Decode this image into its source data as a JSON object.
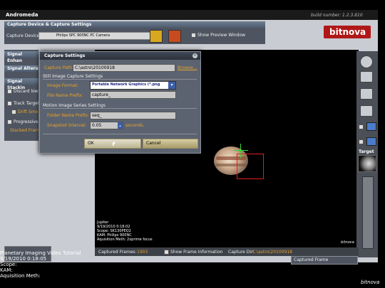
{
  "window": {
    "title": "Andromeda",
    "build": "build number: 1.2.3.810"
  },
  "brand": "bitnova",
  "capture_device": {
    "section": "Capture Device & Capture Settings",
    "label": "Capture Device:",
    "value": "Philips SPC 900NC PC Camera",
    "show_preview": "Show Preview Window"
  },
  "left_panel": {
    "signal_enhance": "Signal Enhan",
    "signal_alter": "Signal Altera",
    "signal_stack": "Signal Stackin",
    "discard": "Discard low",
    "track": "Track Target",
    "drift": "Drift Smoot",
    "progressive": "Progressive",
    "stacked": "Stacked Frame"
  },
  "dialog": {
    "title": "Capture Settings",
    "capture_path_label": "Capture Path:",
    "capture_path": "C:\\astro\\20100918",
    "browse": "Browse...",
    "still_section": "Still Image Capture Settings",
    "image_format_label": "Image Format:",
    "image_format": "Portable Network Graphics (*.png",
    "file_prefix_label": "File Name Prefix:",
    "file_prefix": "capture_",
    "motion_section": "Motion Image Series Settings",
    "folder_prefix_label": "Folder Name Prefix:",
    "folder_prefix": "seq_",
    "interval_label": "Snapshot Interval:",
    "interval": "0.05",
    "seconds": "seconds.",
    "ok": "OK",
    "cancel": "Cancel"
  },
  "overlay": {
    "line1": "Jupiter",
    "line2": "9/19/2010 0:18:02",
    "line3": "Scope: SK130PEQ2",
    "line4": "KAM: Philips 900NC",
    "line5": "Aquisition Meth: 2xprime focus",
    "brand": "bitnova"
  },
  "bottom": {
    "captured_frames_label": "Captured Frames:",
    "captured_frames": "1903",
    "show_frame_info": "Show Frame Information",
    "capture_dir_label": "Capture Dir:",
    "capture_dir": "C:\\astro\\20100918",
    "captured_frame": "Captured Frame"
  },
  "right": {
    "target": "Target"
  },
  "subtitle": {
    "line1": "Planetary Imaging Video Tutorial",
    "line2": "9/19/2010 0:18:05",
    "line3": "Scope:",
    "line4": "KAM:",
    "line5": "Aquisition Meth:",
    "brand": "bitnova"
  }
}
